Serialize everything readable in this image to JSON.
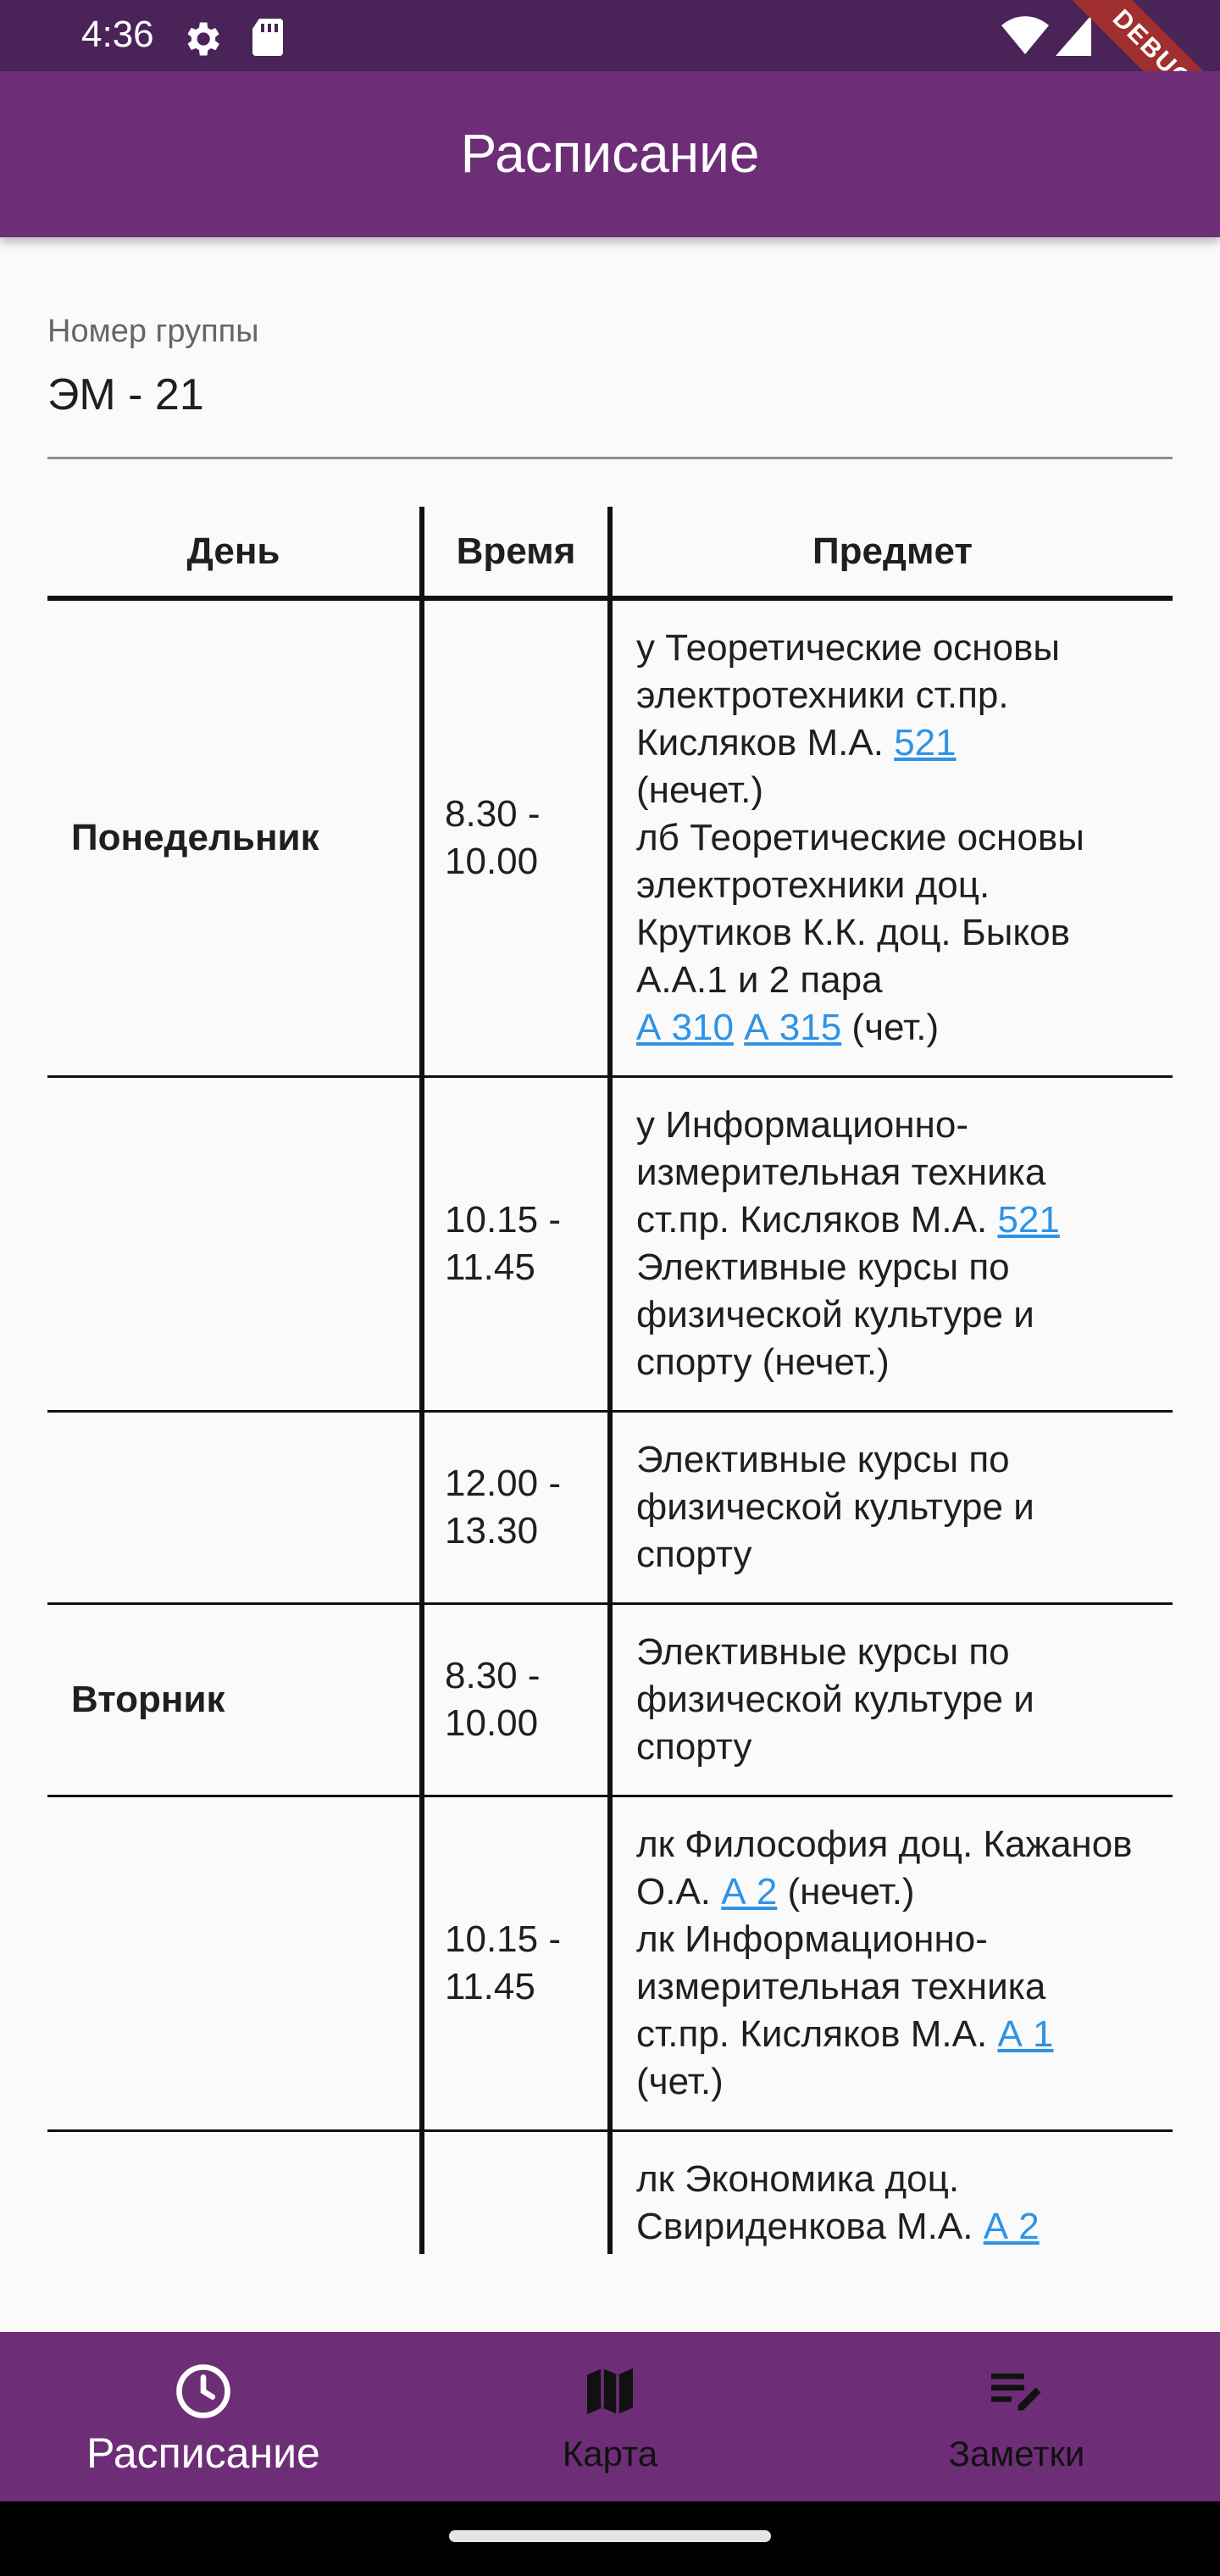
{
  "status_bar": {
    "time": "4:36",
    "debug_label": "DEBUG"
  },
  "app_bar": {
    "title": "Расписание"
  },
  "group_field": {
    "label": "Номер группы",
    "value": "ЭМ - 21"
  },
  "table": {
    "headers": {
      "day": "День",
      "time": "Время",
      "subject": "Предмет"
    },
    "rows": [
      {
        "day": "Понедельник",
        "time": "8.30 -\n10.00",
        "subject": [
          {
            "t": "у Теоретические основы электротехники ст.пр. Кисляков М.А. "
          },
          {
            "t": "521",
            "link": true
          },
          {
            "t": "\n(нечет.)\n лб Теоретические основы электротехники доц. Крутиков К.К. доц. Быков А.А.1 и 2 пара\n"
          },
          {
            "t": "А 310",
            "link": true
          },
          {
            "t": " "
          },
          {
            "t": "А 315",
            "link": true
          },
          {
            "t": " (чет.)"
          }
        ]
      },
      {
        "day": "",
        "time": "10.15 -\n11.45",
        "subject": [
          {
            "t": "у Информационно-измерительная техника ст.пр. Кисляков М.А. "
          },
          {
            "t": "521",
            "link": true
          },
          {
            "t": "\nЭлективные курсы по физической культуре и спорту (нечет.)"
          }
        ]
      },
      {
        "day": "",
        "time": "12.00 -\n13.30",
        "subject": [
          {
            "t": "Элективные курсы по физической культуре и спорту"
          }
        ]
      },
      {
        "day": "Вторник",
        "time": "8.30 -\n10.00",
        "subject": [
          {
            "t": "Элективные курсы по физической культуре и спорту"
          }
        ]
      },
      {
        "day": "",
        "time": "10.15 -\n11.45",
        "subject": [
          {
            "t": "лк Философия доц. Кажанов О.А. "
          },
          {
            "t": "А 2",
            "link": true
          },
          {
            "t": " (нечет.)\n лк Информационно-измерительная техника ст.пр. Кисляков М.А. "
          },
          {
            "t": "А 1",
            "link": true
          },
          {
            "t": "\n(чет.)"
          }
        ]
      },
      {
        "day": "",
        "time": "",
        "subject": [
          {
            "t": "лк Экономика доц. Свириденкова М.А. "
          },
          {
            "t": "А 2",
            "link": true
          }
        ]
      }
    ]
  },
  "bottom_nav": {
    "items": [
      {
        "label": "Расписание",
        "icon": "clock-icon",
        "active": true
      },
      {
        "label": "Карта",
        "icon": "map-icon",
        "active": false
      },
      {
        "label": "Заметки",
        "icon": "notes-icon",
        "active": false
      }
    ]
  },
  "colors": {
    "app_bar": "#6d2e77",
    "status_bar": "#4a2458",
    "link": "#2f93e6"
  }
}
